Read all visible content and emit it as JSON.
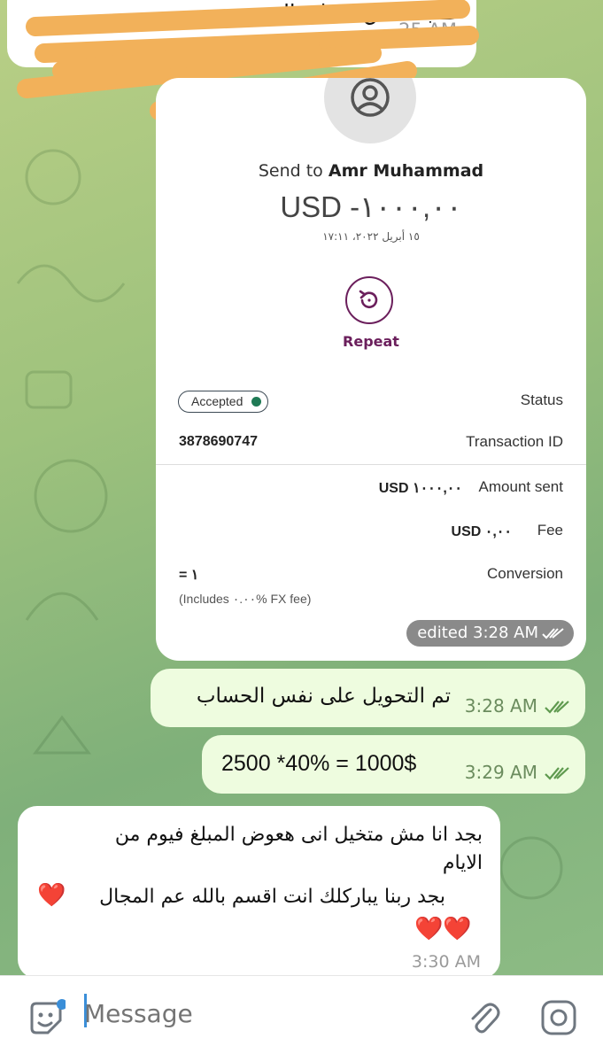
{
  "top_message": {
    "text": "طب ممكن تبعتلى ال هف",
    "time": "25 AM"
  },
  "transfer_card": {
    "send_to_prefix": "Send to",
    "recipient": "Amr Muhammad",
    "amount": "USD -١٠٠٠,٠٠",
    "date": "١٥ أبريل ٢٠٢٢، ١٧:١١",
    "repeat_label": "Repeat",
    "rows": {
      "status_label": "Status",
      "status_value": "Accepted",
      "transaction_label": "Transaction ID",
      "transaction_value": "3878690747",
      "amount_sent_label": "Amount sent",
      "amount_sent_value": "USD ١٠٠٠,٠٠",
      "fee_label": "Fee",
      "fee_value": "USD ٠,٠٠",
      "conversion_label": "Conversion",
      "conversion_value": "= ١",
      "fx_note": "(Includes ٠.٠٠% FX fee)"
    },
    "edited_time": "edited 3:28 AM"
  },
  "messages": [
    {
      "text": "تم التحويل على نفس الحساب",
      "time": "3:28 AM"
    },
    {
      "text": "2500 *40% = 1000$",
      "time": "3:29 AM"
    }
  ],
  "incoming": {
    "line1": "بجد انا مش متخيل انى هعوض المبلغ فيوم من",
    "line2": "الايام",
    "line3": "بجد ربنا يباركلك انت اقسم بالله عم المجال",
    "hearts1": "❤️",
    "hearts2": "❤️❤️",
    "time": "3:30 AM"
  },
  "composer": {
    "placeholder": "Message"
  },
  "colors": {
    "accent": "#6b1f5c",
    "status_green": "#1f7a55",
    "outgoing_bubble": "#eefcdf"
  },
  "icons": [
    "sticker-icon",
    "attach-icon",
    "camera-icon",
    "read-checks-icon",
    "repeat-icon",
    "avatar-icon"
  ]
}
